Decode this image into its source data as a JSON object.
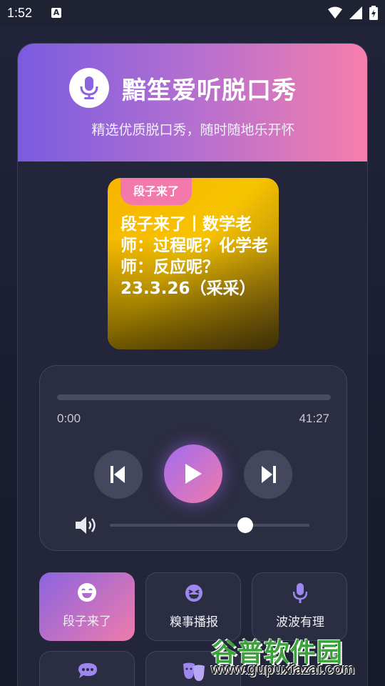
{
  "status_bar": {
    "time": "1:52",
    "a_label": "A"
  },
  "header": {
    "title": "黯笙爱听脱口秀",
    "subtitle": "精选优质脱口秀，随时随地乐开怀"
  },
  "cover": {
    "tag": "段子来了",
    "title": "段子来了丨数学老师：过程呢？化学老师：反应呢？23.3.26（采采）",
    "bg_color": "#f7b500"
  },
  "player": {
    "current_time": "0:00",
    "duration": "41:27",
    "progress": 0.0,
    "volume": 0.68
  },
  "categories": [
    {
      "label": "段子来了",
      "icon": "laugh-icon",
      "active": true
    },
    {
      "label": "糗事播报",
      "icon": "laugh-squint-icon",
      "active": false
    },
    {
      "label": "波波有理",
      "icon": "microphone-icon",
      "active": false
    },
    {
      "label": "",
      "icon": "comment-icon",
      "active": false
    },
    {
      "label": "",
      "icon": "masks-icon",
      "active": false
    }
  ],
  "watermark": {
    "brand": "谷普软件园",
    "url": "www.gupuxiazai.com"
  },
  "colors": {
    "accent_purple": "#8b64e0",
    "accent_pink": "#ef7bab",
    "card_bg": "#23253a"
  }
}
